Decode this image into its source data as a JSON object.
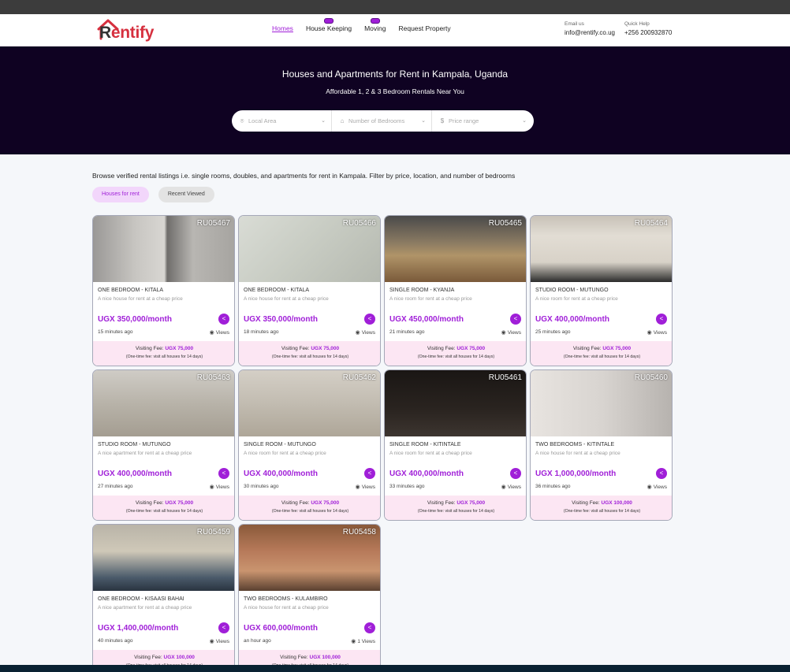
{
  "brand": {
    "name_prefix": "R",
    "name_suffix": "entify"
  },
  "nav": [
    {
      "label": "Homes",
      "active": true,
      "badge": false
    },
    {
      "label": "House Keeping",
      "active": false,
      "badge": true
    },
    {
      "label": "Moving",
      "active": false,
      "badge": true
    },
    {
      "label": "Request Property",
      "active": false,
      "badge": false
    }
  ],
  "contact": {
    "email_label": "Email us",
    "email": "info@rentify.co.ug",
    "help_label": "Quick Help",
    "phone": "+256 200932870"
  },
  "hero": {
    "title": "Houses and Apartments for Rent in Kampala, Uganda",
    "subtitle": "Affordable 1, 2 & 3 Bedroom Rentals Near You"
  },
  "search": {
    "area_placeholder": "Local Area",
    "bedrooms_placeholder": "Number of Bedrooms",
    "price_placeholder": "Price range"
  },
  "intro": "Browse verified rental listings i.e. single rooms, doubles, and apartments for rent in Kampala. Filter by price, location, and number of bedrooms",
  "tabs": {
    "houses": "Houses for rent",
    "recent": "Recent Viewed"
  },
  "fee_label": "Visiting Fee:",
  "fee_note": "(One-time fee: visit all houses for 14 days)",
  "listings": [
    {
      "code": "RU05467",
      "title": "ONE BEDROOM - KITALA",
      "desc": "A nice house for rent at a cheap price",
      "price": "UGX 350,000/month",
      "time": "15 minutes ago",
      "views": "Views",
      "fee": "UGX 75,000"
    },
    {
      "code": "RU05466",
      "title": "ONE BEDROOM - KITALA",
      "desc": "A nice house for rent at a cheap price",
      "price": "UGX 350,000/month",
      "time": "18 minutes ago",
      "views": "Views",
      "fee": "UGX 75,000"
    },
    {
      "code": "RU05465",
      "title": "SINGLE ROOM - KYANJA",
      "desc": "A nice room for rent at a cheap price",
      "price": "UGX 450,000/month",
      "time": "21 minutes ago",
      "views": "Views",
      "fee": "UGX 75,000"
    },
    {
      "code": "RU05464",
      "title": "STUDIO ROOM - MUTUNGO",
      "desc": "A nice room for rent at a cheap price",
      "price": "UGX 400,000/month",
      "time": "25 minutes ago",
      "views": "Views",
      "fee": "UGX 75,000"
    },
    {
      "code": "RU05463",
      "title": "STUDIO ROOM - MUTUNGO",
      "desc": "A nice apartment for rent at a cheap price",
      "price": "UGX 400,000/month",
      "time": "27 minutes ago",
      "views": "Views",
      "fee": "UGX 75,000"
    },
    {
      "code": "RU05462",
      "title": "SINGLE ROOM - MUTUNGO",
      "desc": "A nice room for rent at a cheap price",
      "price": "UGX 400,000/month",
      "time": "30 minutes ago",
      "views": "Views",
      "fee": "UGX 75,000"
    },
    {
      "code": "RU05461",
      "title": "SINGLE ROOM - KITINTALE",
      "desc": "A nice room for rent at a cheap price",
      "price": "UGX 400,000/month",
      "time": "33 minutes ago",
      "views": "Views",
      "fee": "UGX 75,000"
    },
    {
      "code": "RU05460",
      "title": "TWO BEDROOMS - KITINTALE",
      "desc": "A nice house for rent at a cheap price",
      "price": "UGX 1,000,000/month",
      "time": "36 minutes ago",
      "views": "Views",
      "fee": "UGX 100,000"
    },
    {
      "code": "RU05459",
      "title": "ONE BEDROOM - KISAASI BAHAI",
      "desc": "A nice apartment for rent at a cheap price",
      "price": "UGX 1,400,000/month",
      "time": "40 minutes ago",
      "views": "Views",
      "fee": "UGX 100,000"
    },
    {
      "code": "RU05458",
      "title": "TWO BEDROOMS - KULAMBIRO",
      "desc": "A nice house for rent at a cheap price",
      "price": "UGX 600,000/month",
      "time": "an hour ago",
      "views": "1 Views",
      "fee": "UGX 100,000"
    }
  ],
  "colors": {
    "accent": "#a01fd8",
    "hero_bg": "#0f0222",
    "fee_bg": "#fce6f3",
    "logo_red": "#d6303f"
  }
}
